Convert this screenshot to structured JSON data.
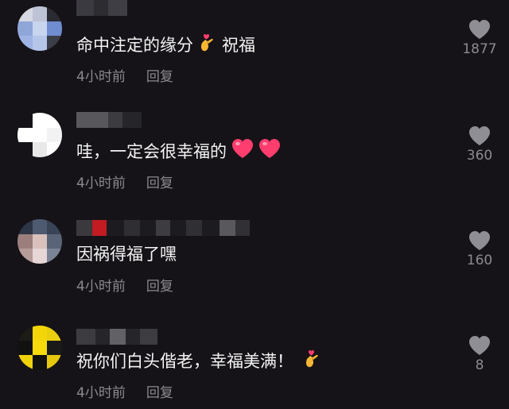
{
  "comments": [
    {
      "text": "命中注定的缘分",
      "suffix": "祝福",
      "time": "4小时前",
      "reply": "回复",
      "likes": "1877",
      "emojis": [
        "finger-heart"
      ]
    },
    {
      "text": "哇，一定会很幸福的",
      "suffix": "",
      "time": "4小时前",
      "reply": "回复",
      "likes": "360",
      "emojis": [
        "heart",
        "heart"
      ]
    },
    {
      "text": "因祸得福了嘿",
      "suffix": "",
      "time": "4小时前",
      "reply": "回复",
      "likes": "160",
      "emojis": []
    },
    {
      "text": "祝你们白头偕老，幸福美满！",
      "suffix": "",
      "time": "4小时前",
      "reply": "回复",
      "likes": "8",
      "emojis": [
        "finger-heart"
      ]
    }
  ],
  "colors": {
    "background": "#161318",
    "text": "#f4f4f4",
    "muted": "#8b8a90",
    "like_icon": "#8f8e94",
    "heart_emoji": "#ff3d6e"
  }
}
